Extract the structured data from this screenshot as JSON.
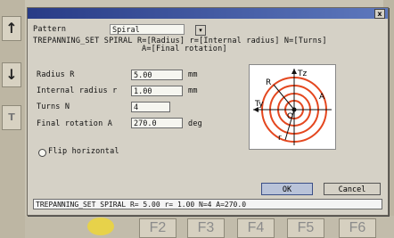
{
  "dialog": {
    "close_glyph": "x",
    "pattern_label": "Pattern",
    "pattern_value": "Spiral",
    "syntax_line1": "TREPANNING_SET SPIRAL R=[Radius] r=[Internal radius] N=[Turns]",
    "syntax_line2": "A=[Final rotation]",
    "fields": [
      {
        "label": "Radius R",
        "value": "5.00",
        "unit": "mm"
      },
      {
        "label": "Internal radius r",
        "value": "1.00",
        "unit": "mm"
      },
      {
        "label": "Turns N",
        "value": "4",
        "unit": ""
      },
      {
        "label": "Final rotation A",
        "value": "270.0",
        "unit": "deg"
      }
    ],
    "flip_label": "Flip horizontal",
    "ok_label": "OK",
    "cancel_label": "Cancel",
    "status_text": "TREPANNING_SET SPIRAL R= 5.00 r= 1.00 N=4 A=270.0",
    "diagram_labels": {
      "ty": "Ty",
      "tz": "Tz",
      "R": "R",
      "r": "r",
      "A": "A",
      "O": "O"
    }
  },
  "background": {
    "fkeys": [
      "F2",
      "F3",
      "F4",
      "F5",
      "F6"
    ]
  },
  "colors": {
    "spiral": "#e4471f",
    "title": "#283b86"
  }
}
